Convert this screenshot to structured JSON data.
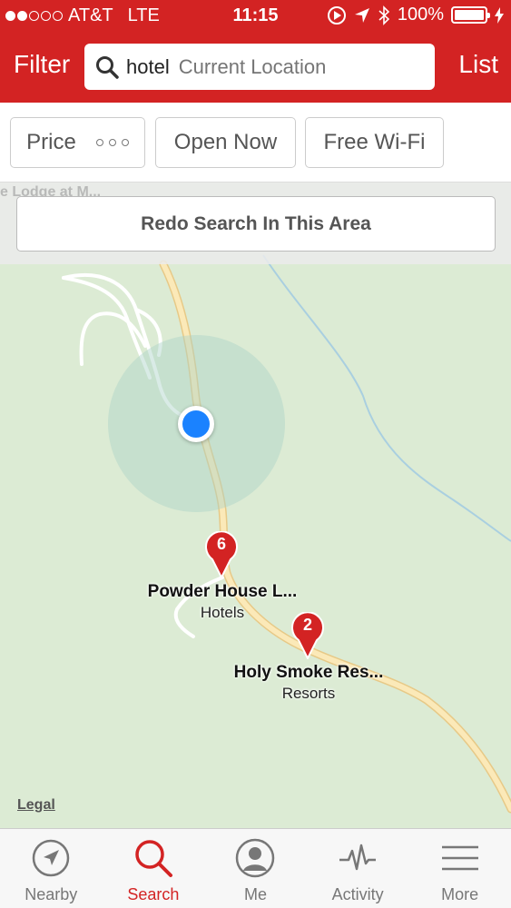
{
  "status_bar": {
    "carrier": "AT&T",
    "network": "LTE",
    "time": "11:15",
    "battery": "100%",
    "battery_level": 1.0,
    "signal_bars_filled": 2,
    "signal_bars_total": 5
  },
  "header": {
    "filter_label": "Filter",
    "list_label": "List",
    "search_term": "hotel",
    "location_placeholder": "Current Location"
  },
  "filters": {
    "price_label": "Price",
    "open_now_label": "Open Now",
    "wifi_label": "Free Wi-Fi"
  },
  "map": {
    "partial_label": "e Lodge at M...",
    "redo_label": "Redo Search In This Area",
    "legal_label": "Legal",
    "pins": [
      {
        "number": "6",
        "name": "Powder House L...",
        "category": "Hotels"
      },
      {
        "number": "2",
        "name": "Holy Smoke Res...",
        "category": "Resorts"
      }
    ]
  },
  "tabs": [
    {
      "label": "Nearby",
      "icon": "compass-arrow-icon",
      "active": false
    },
    {
      "label": "Search",
      "icon": "search-icon",
      "active": true
    },
    {
      "label": "Me",
      "icon": "profile-icon",
      "active": false
    },
    {
      "label": "Activity",
      "icon": "activity-pulse-icon",
      "active": false
    },
    {
      "label": "More",
      "icon": "menu-lines-icon",
      "active": false
    }
  ],
  "colors": {
    "brand_red": "#d32323",
    "map_green": "#dcebd4",
    "road": "#f5dfa0",
    "location_blue": "#1a82ff"
  }
}
